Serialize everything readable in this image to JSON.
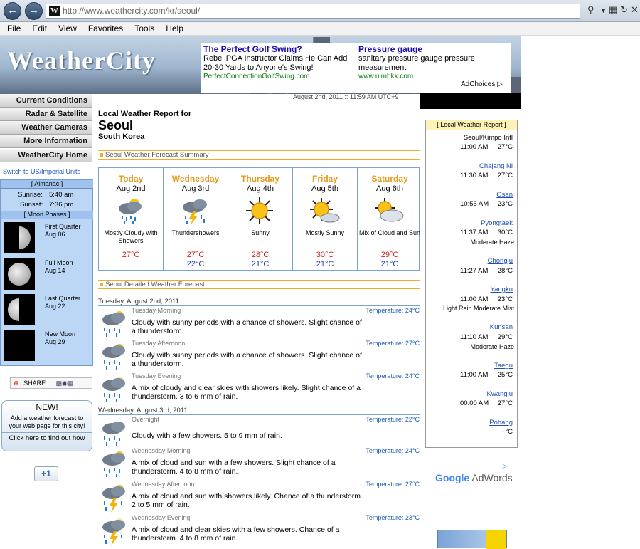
{
  "browser": {
    "url": "http://www.weathercity.com/kr/seoul/",
    "menu": [
      "File",
      "Edit",
      "View",
      "Favorites",
      "Tools",
      "Help"
    ]
  },
  "site": {
    "logo": "WeatherCity",
    "dateline": "August 2nd, 2011 :: 11:59 AM UTC+9"
  },
  "ad": {
    "title1": "The Perfect Golf Swing?",
    "body1": "Rebel PGA Instructor Claims He Can Add 20-30 Yards to Anyone's Swing!",
    "url1": "PerfectConnectionGolfSwing.com",
    "title2": "Pressure gauge",
    "body2": "sanitary pressure gauge pressure measurement",
    "url2": "www.uimbkk.com",
    "adchoices": "AdChoices"
  },
  "nav": {
    "items": [
      "Current Conditions",
      "Radar & Satellite",
      "Weather Cameras",
      "More Information",
      "WeatherCity Home"
    ],
    "units_link": "Switch to US/Imperial Units"
  },
  "almanac": {
    "head": "[ Almanac ]",
    "sunrise_label": "Sunrise:",
    "sunrise": "5:40 am",
    "sunset_label": "Sunset:",
    "sunset": "7:36 pm",
    "moon_head": "[ Moon Phases ]",
    "phases": [
      {
        "name": "First Quarter",
        "date": "Aug 06"
      },
      {
        "name": "Full Moon",
        "date": "Aug 14"
      },
      {
        "name": "Last Quarter",
        "date": "Aug 22"
      },
      {
        "name": "New Moon",
        "date": "Aug 29"
      }
    ]
  },
  "widgets": {
    "share": "SHARE",
    "promo_new": "NEW!",
    "promo_text": "Add a weather forecast to your web page for this city!",
    "promo_link": "Click here to find out how",
    "plusone": "+1"
  },
  "report": {
    "label": "Local Weather Report for",
    "city": "Seoul",
    "country": "South Korea",
    "summary_head": "Seoul Weather Forecast Summary",
    "detail_head": "Seoul Detailed Weather Forecast"
  },
  "forecast": [
    {
      "day": "Today",
      "date": "Aug 2nd",
      "icon": "cloud-rain-icon",
      "desc": "Mostly Cloudy with Showers",
      "hi": "27°C",
      "lo": ""
    },
    {
      "day": "Wednesday",
      "date": "Aug 3rd",
      "icon": "thunderstorm-icon",
      "desc": "Thundershowers",
      "hi": "27°C",
      "lo": "22°C"
    },
    {
      "day": "Thursday",
      "date": "Aug 4th",
      "icon": "sun-icon",
      "desc": "Sunny",
      "hi": "28°C",
      "lo": "21°C"
    },
    {
      "day": "Friday",
      "date": "Aug 5th",
      "icon": "mostly-sunny-icon",
      "desc": "Mostly Sunny",
      "hi": "30°C",
      "lo": "21°C"
    },
    {
      "day": "Saturday",
      "date": "Aug 6th",
      "icon": "cloud-sun-icon",
      "desc": "Mix of Cloud and Sun",
      "hi": "29°C",
      "lo": "21°C"
    }
  ],
  "detailed": {
    "day1": "Tuesday, August 2nd, 2011",
    "day2": "Wednesday, August 3rd, 2011",
    "temp_label": "Temperature:",
    "rows": [
      {
        "period": "Tuesday Morning",
        "temp": "24°C",
        "text": "Cloudy with sunny periods with a chance of showers. Slight chance of a thunderstorm."
      },
      {
        "period": "Tuesday Afternoon",
        "temp": "27°C",
        "text": "Cloudy with sunny periods with a chance of showers. Slight chance of a thunderstorm."
      },
      {
        "period": "Tuesday Evening",
        "temp": "24°C",
        "text": "A mix of cloudy and clear skies with showers likely. Slight chance of a thunderstorm. 3 to 6 mm of rain."
      },
      {
        "period": "Overnight",
        "temp": "22°C",
        "text": "Cloudy with a few showers. 5 to 9 mm of rain."
      },
      {
        "period": "Wednesday Morning",
        "temp": "24°C",
        "text": "A mix of cloud and sun with a few showers. Slight chance of a thunderstorm. 4 to 8 mm of rain."
      },
      {
        "period": "Wednesday Afternoon",
        "temp": "27°C",
        "text": "A mix of cloud and sun with showers likely. Chance of a thunderstorm. 2 to 5 mm of rain."
      },
      {
        "period": "Wednesday Evening",
        "temp": "23°C",
        "text": "A mix of cloud and clear skies with a few showers. Chance of a thunderstorm. 4 to 8 mm of rain."
      }
    ]
  },
  "local": {
    "head": "[ Local Weather Report ]",
    "stations": [
      {
        "name": "Seoul/Kimpo Intl",
        "time": "11:00 AM",
        "temp": "27°C",
        "cond": ""
      },
      {
        "name": "Chajang Ni",
        "time": "11:30 AM",
        "temp": "27°C",
        "cond": ""
      },
      {
        "name": "Osan",
        "time": "10:55 AM",
        "temp": "23°C",
        "cond": ""
      },
      {
        "name": "Pyongtaek",
        "time": "11:37 AM",
        "temp": "30°C",
        "cond": "Moderate Haze"
      },
      {
        "name": "Chongju",
        "time": "11:27 AM",
        "temp": "28°C",
        "cond": ""
      },
      {
        "name": "Yangku",
        "time": "11:00 AM",
        "temp": "23°C",
        "cond": "Light Rain Moderate Mist"
      },
      {
        "name": "Kunsan",
        "time": "11:10 AM",
        "temp": "29°C",
        "cond": "Moderate Haze"
      },
      {
        "name": "Taegu",
        "time": "11:00 AM",
        "temp": "25°C",
        "cond": ""
      },
      {
        "name": "Kwangju",
        "time": "00:00 AM",
        "temp": "27°C",
        "cond": ""
      },
      {
        "name": "Pohang",
        "time": "",
        "temp": "--°C",
        "cond": ""
      }
    ]
  },
  "adwords": {
    "google": "Google",
    "adwords": "AdWords"
  }
}
